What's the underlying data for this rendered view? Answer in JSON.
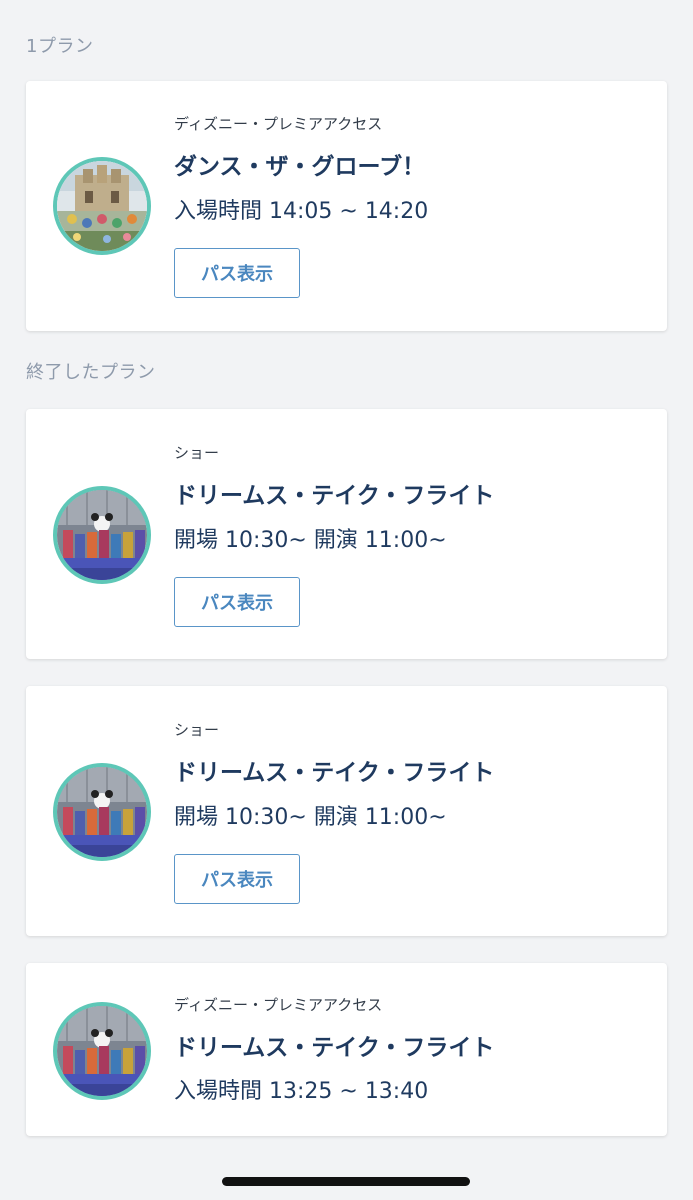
{
  "sections": {
    "active_title": "1プラン",
    "ended_title": "終了したプラン"
  },
  "cards": [
    {
      "category": "ディズニー・プレミアアクセス",
      "name": "ダンス・ザ・グローブ！",
      "time": "入場時間 14:05 ~ 14:20",
      "button": "パス表示",
      "image": "castle-show-photo"
    },
    {
      "category": "ショー",
      "name": "ドリームス・テイク・フライト",
      "time": "開場 10:30~ 開演 11:00~",
      "button": "パス表示",
      "image": "stage-show-photo"
    },
    {
      "category": "ショー",
      "name": "ドリームス・テイク・フライト",
      "time": "開場 10:30~ 開演 11:00~",
      "button": "パス表示",
      "image": "stage-show-photo"
    },
    {
      "category": "ディズニー・プレミアアクセス",
      "name": "ドリームス・テイク・フライト",
      "time": "入場時間 13:25 ~ 13:40",
      "image": "stage-show-photo"
    }
  ],
  "colors": {
    "accent_ring": "#5ec7b7",
    "button_border": "#5a95c8",
    "title_text": "#1f3a5f",
    "section_text": "#8e9aab"
  }
}
